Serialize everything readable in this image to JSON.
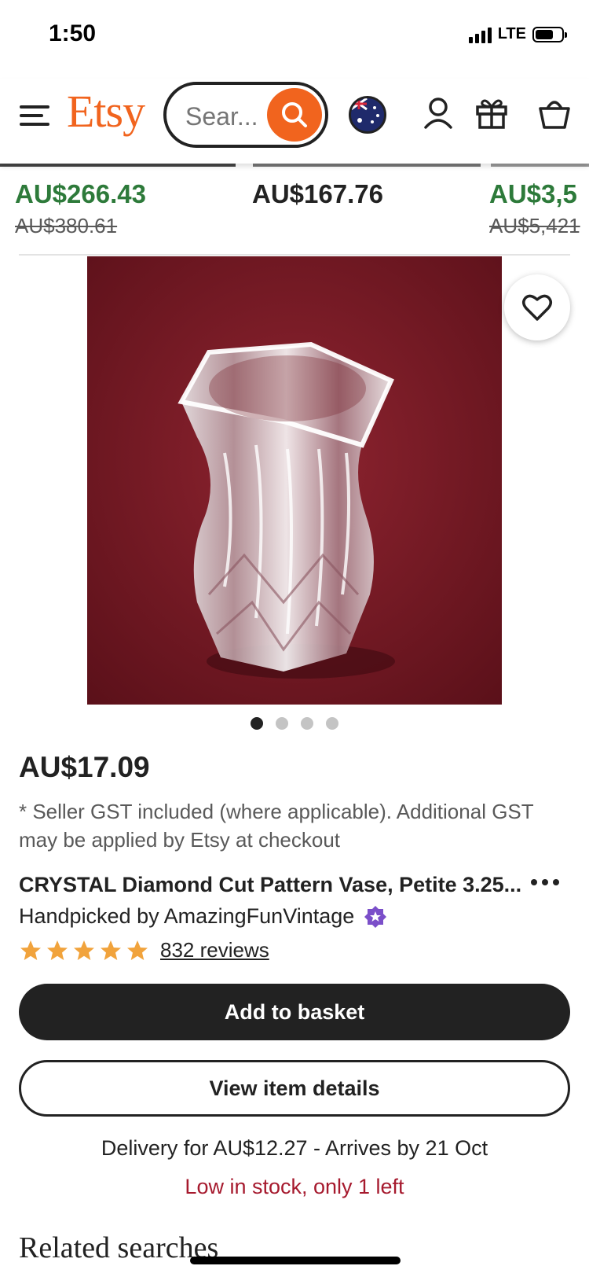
{
  "status_bar": {
    "time": "1:50",
    "network": "LTE"
  },
  "header": {
    "logo": "Etsy",
    "search": {
      "placeholder": "Sear..."
    },
    "icons": [
      "menu-icon",
      "search-icon",
      "australia-flag-icon",
      "account-icon",
      "gift-icon",
      "basket-icon"
    ],
    "brand_color": "#F1641E"
  },
  "price_strip": [
    {
      "price": "AU$266.43",
      "original_price": "AU$380.61",
      "price_color": "#2d7a3a"
    },
    {
      "price": "AU$167.76",
      "original_price": ""
    },
    {
      "price": "AU$3,5",
      "original_price": "AU$5,421",
      "price_color": "#2d7a3a"
    }
  ],
  "product": {
    "image_count": 4,
    "active_image": 1,
    "price": "AU$17.09",
    "gst_note": "* Seller GST included (where applicable). Additional GST may be applied by Etsy at checkout",
    "title": "CRYSTAL Diamond Cut Pattern Vase, Petite 3.25...",
    "seller_line": "Handpicked by AmazingFunVintage",
    "rating_stars": 5,
    "reviews": "832 reviews",
    "add_to_basket": "Add to basket",
    "view_details": "View item details",
    "delivery": "Delivery for AU$12.27 - Arrives by 21 Oct",
    "stock": "Low in stock, only 1 left",
    "stock_color": "#A61A2E"
  },
  "related": {
    "heading": "Related searches"
  }
}
